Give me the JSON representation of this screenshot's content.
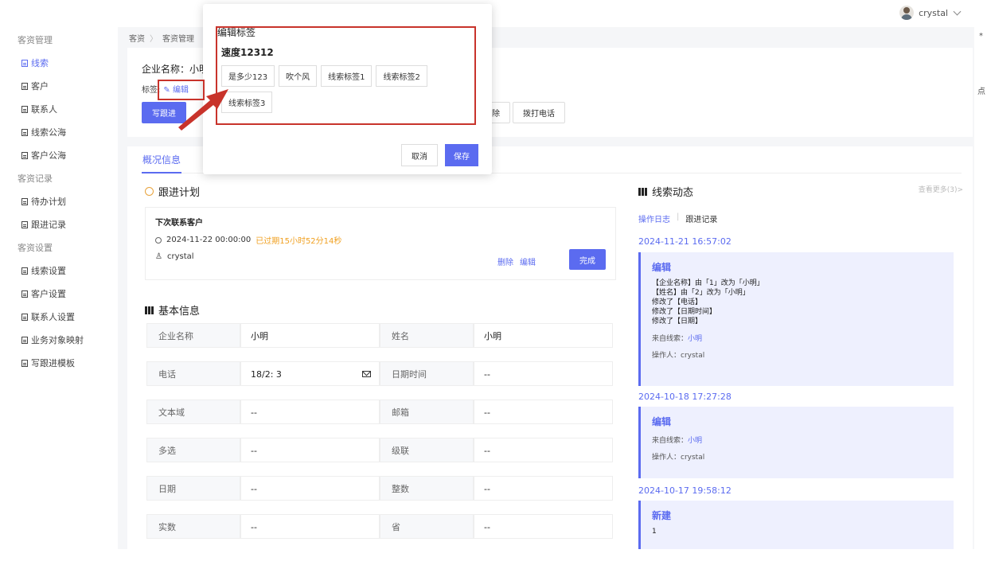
{
  "user": {
    "name": "crystal"
  },
  "sidebar": {
    "groups": [
      {
        "title": "客资管理",
        "items": [
          {
            "label": "线索",
            "active": true
          },
          {
            "label": "客户"
          },
          {
            "label": "联系人"
          },
          {
            "label": "线索公海"
          },
          {
            "label": "客户公海"
          }
        ]
      },
      {
        "title": "客资记录",
        "items": [
          {
            "label": "待办计划"
          },
          {
            "label": "跟进记录"
          }
        ]
      },
      {
        "title": "客资设置",
        "items": [
          {
            "label": "线索设置"
          },
          {
            "label": "客户设置"
          },
          {
            "label": "联系人设置"
          },
          {
            "label": "业务对象映射"
          },
          {
            "label": "写跟进模板"
          }
        ]
      }
    ]
  },
  "breadcrumb": [
    "客资",
    "客资管理"
  ],
  "header": {
    "company": "企业名称：小明",
    "tag_label": "标签:",
    "edit_label": "编辑",
    "actions": [
      "写跟进",
      "除",
      "拨打电话"
    ]
  },
  "tabs": {
    "overview": "概况信息"
  },
  "plan": {
    "section_title": "跟进计划",
    "title": "下次联系客户",
    "time": "2024-11-22 00:00:00",
    "overdue": "已过期15小时52分14秒",
    "user": "crystal",
    "delete": "删除",
    "edit": "编辑",
    "done": "完成"
  },
  "basic_info": {
    "section_title": "基本信息",
    "rows": [
      {
        "l1": "企业名称",
        "v1": "小明",
        "l2": "姓名",
        "v2": "小明"
      },
      {
        "l1": "电话",
        "v1": "18/2:      3",
        "l2": "日期时间",
        "v2": "--"
      },
      {
        "l1": "文本域",
        "v1": "--",
        "l2": "邮箱",
        "v2": "--"
      },
      {
        "l1": "多选",
        "v1": "--",
        "l2": "级联",
        "v2": "--"
      },
      {
        "l1": "日期",
        "v1": "--",
        "l2": "整数",
        "v2": "--"
      },
      {
        "l1": "实数",
        "v1": "--",
        "l2": "省",
        "v2": "--"
      }
    ]
  },
  "activity": {
    "title": "线索动态",
    "more": "查看更多(3)>",
    "tab_log": "操作日志",
    "tab_follow": "跟进记录",
    "entries": [
      {
        "date": "2024-11-21 16:57:02",
        "head": "编辑",
        "lines": [
          "【企业名称】由「1」改为「小明」",
          "【姓名】由「2」改为「小明」",
          "修改了【电话】",
          "修改了【日期时间】",
          "修改了【日期】"
        ],
        "source_label": "来自线索：",
        "source": "小明",
        "op_label": "操作人：",
        "op": "crystal"
      },
      {
        "date": "2024-10-18 17:27:28",
        "head": "编辑",
        "lines": [],
        "source_label": "来自线索：",
        "source": "小明",
        "op_label": "操作人：",
        "op": "crystal"
      },
      {
        "date": "2024-10-17 19:58:12",
        "head": "新建",
        "lines": [
          "1"
        ]
      }
    ]
  },
  "popup": {
    "title": "编辑标签",
    "subtitle": "速度12312",
    "tags": [
      "是多少123",
      "吹个风",
      "线索标签1",
      "线索标签2",
      "线索标签3"
    ],
    "cancel": "取消",
    "save": "保存"
  },
  "edge": {
    "a": "*",
    "b": "点"
  },
  "colors": {
    "accent": "#5b6bf0",
    "highlight": "#c8332b",
    "warning": "#f0a020"
  }
}
